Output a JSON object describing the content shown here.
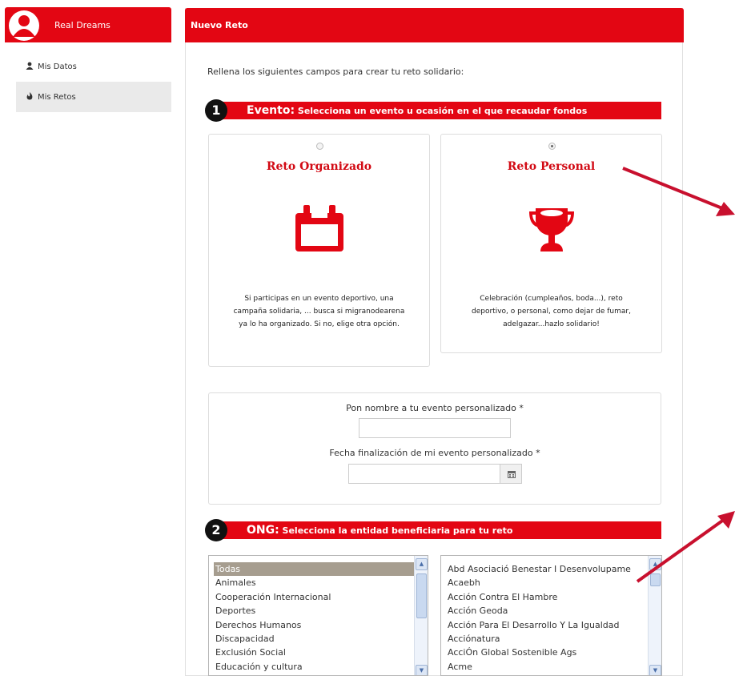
{
  "sidebar": {
    "brand": "Real Dreams",
    "items": [
      {
        "label": "Mis Datos",
        "icon": "user-icon"
      },
      {
        "label": "Mis Retos",
        "icon": "fire-icon"
      }
    ]
  },
  "main": {
    "title": "Nuevo Reto",
    "intro": "Rellena los siguientes campos para crear tu reto solidario:"
  },
  "step1": {
    "number": "1",
    "heading": "Evento:",
    "subheading": " Selecciona un evento u ocasión en el que recaudar fondos",
    "options": [
      {
        "title": "Reto Organizado",
        "icon": "calendar-icon",
        "description": "Si participas en un evento deportivo, una campaña solidaria, ... busca si migranodearena ya lo ha organizado. Si no, elige otra opción.",
        "selected": false
      },
      {
        "title": "Reto Personal",
        "icon": "trophy-icon",
        "description": "Celebración (cumpleaños, boda...), reto deportivo, o personal, como dejar de fumar, adelgazar...hazlo solidario!",
        "selected": true
      }
    ]
  },
  "custom_event": {
    "name_label": "Pon nombre a tu evento personalizado *",
    "name_value": "",
    "date_label": "Fecha finalización de mi evento personalizado *",
    "date_value": ""
  },
  "step2": {
    "number": "2",
    "heading": "ONG:",
    "subheading": " Selecciona la entidad beneficiaria para tu reto",
    "categories": [
      "Todas",
      "Animales",
      "Cooperación Internacional",
      "Deportes",
      "Derechos Humanos",
      "Discapacidad",
      "Exclusión Social",
      "Educación y cultura"
    ],
    "selected_category": "Todas",
    "organizations": [
      "Abd Asociació Benestar I Desenvolupame",
      "Acaebh",
      "Acción Contra El Hambre",
      "Acción Geoda",
      "Acción Para El Desarrollo Y La Igualdad",
      "Acciónatura",
      "AcciÓn Global Sostenible Ags",
      "Acme"
    ]
  },
  "colors": {
    "brand": "#e30613",
    "annotation_arrow": "#c8102e"
  }
}
